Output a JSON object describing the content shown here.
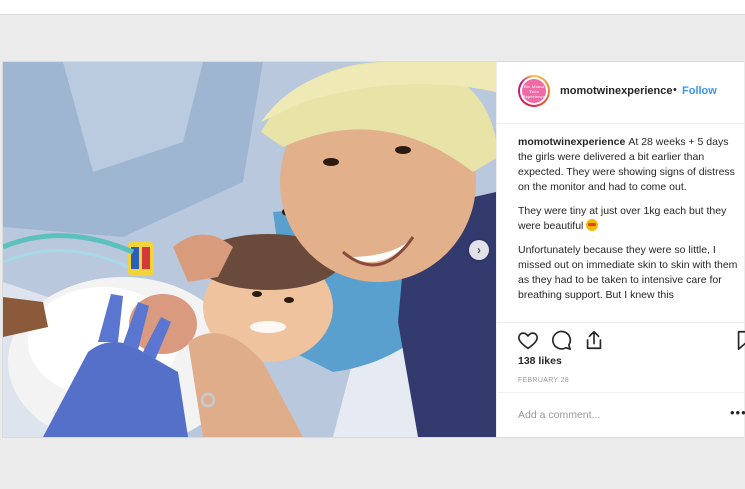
{
  "post": {
    "username": "momotwinexperience",
    "separator": "•",
    "follow_label": "Follow",
    "avatar_text": "the Momo Twin Experience",
    "caption_user": "momotwinexperience",
    "caption_paragraphs": [
      "At 28 weeks + 5 days the girls were delivered a bit earlier than expected. They were showing signs of distress on the monitor and had to come out.",
      "They were tiny at just over 1kg each but they were beautiful",
      "Unfortunately because they were so little, I missed out on immediate skin to skin with them as they had to be taken to intensive care for breathing support. But I knew this"
    ],
    "likes": "138 likes",
    "date": "FEBRUARY 28",
    "comment_placeholder": "Add a comment...",
    "more_label": "•••",
    "carousel_next": "›",
    "icons": {
      "like": "heart-icon",
      "comment": "comment-icon",
      "share": "share-icon",
      "save": "bookmark-icon"
    },
    "colors": {
      "follow": "#3897f0",
      "text": "#262626",
      "muted": "#999999",
      "border": "#dbdbdb"
    }
  }
}
